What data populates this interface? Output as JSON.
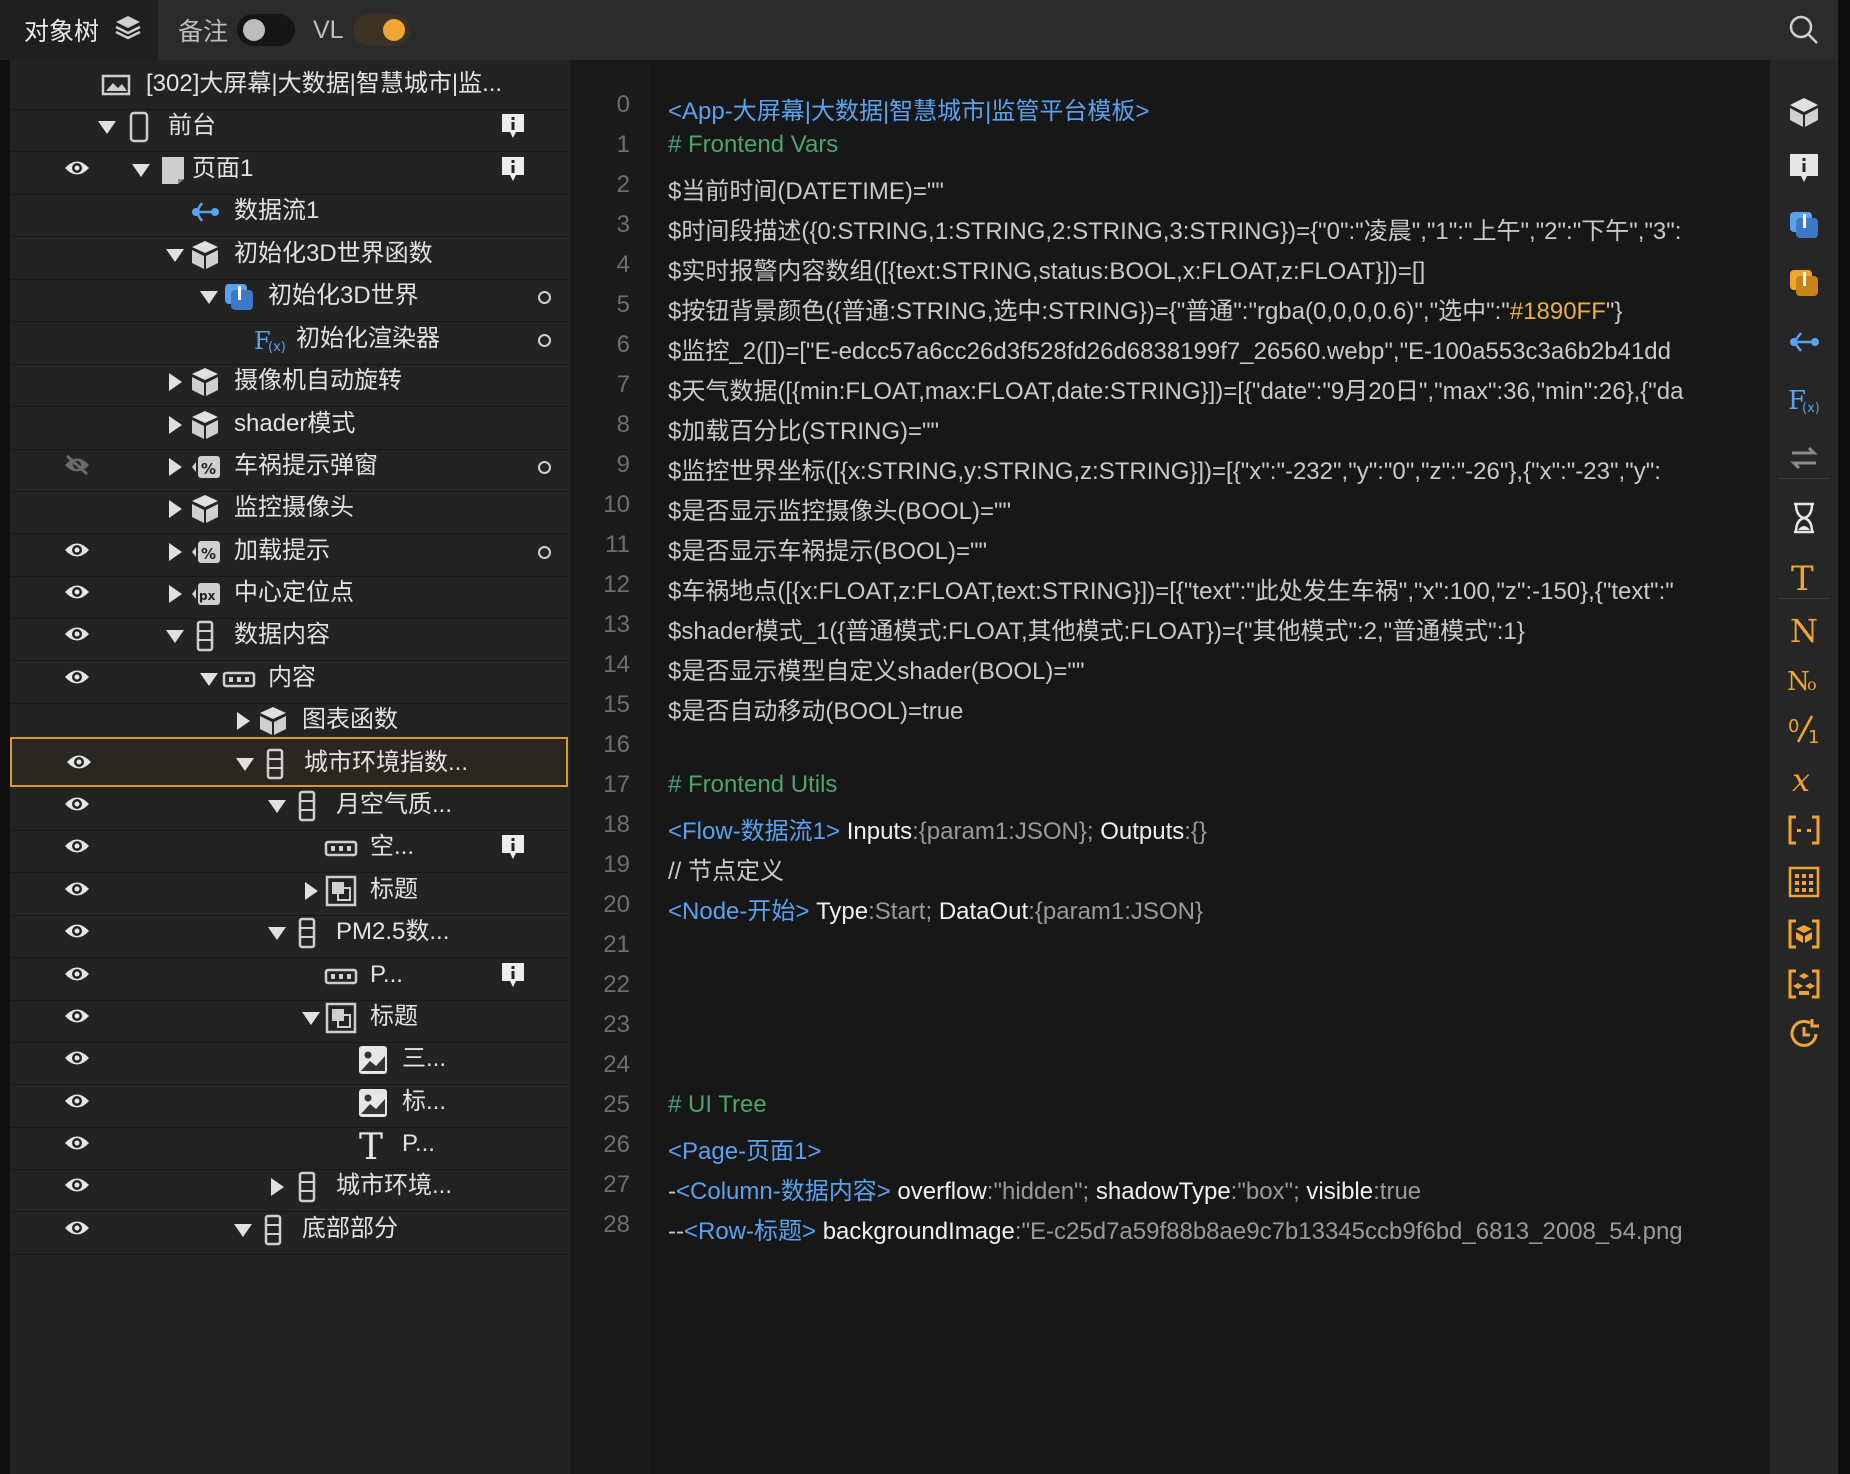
{
  "topbar": {
    "tab_object_tree": "对象树",
    "notes_label": "备注",
    "vl_label": "VL",
    "notes_toggle_on": false,
    "vl_toggle_on": true
  },
  "tree": {
    "project": "[302]大屏幕|大数据|智慧城市|监...",
    "nodes": [
      {
        "label": "前台",
        "icon": "mobile-icon",
        "expand": "down"
      },
      {
        "label": "页面1",
        "icon": "page-icon",
        "expand": "down"
      },
      {
        "label": "数据流1",
        "icon": "flow-icon",
        "expand": ""
      },
      {
        "label": "初始化3D世界函数",
        "icon": "cube-icon",
        "expand": "down"
      },
      {
        "label": "初始化3D世界",
        "icon": "scene-icon",
        "expand": "down"
      },
      {
        "label": "初始化渲染器",
        "icon": "function-icon",
        "expand": ""
      },
      {
        "label": "摄像机自动旋转",
        "icon": "cube-icon",
        "expand": "right"
      },
      {
        "label": "shader模式",
        "icon": "cube-icon",
        "expand": "right"
      },
      {
        "label": "车祸提示弹窗",
        "icon": "percent-icon",
        "expand": "right"
      },
      {
        "label": "监控摄像头",
        "icon": "cube-icon",
        "expand": "right"
      },
      {
        "label": "加载提示",
        "icon": "percent-icon",
        "expand": "right"
      },
      {
        "label": "中心定位点",
        "icon": "px-icon",
        "expand": "right"
      },
      {
        "label": "数据内容",
        "icon": "column-icon",
        "expand": "down"
      },
      {
        "label": "内容",
        "icon": "row-icon",
        "expand": "down"
      },
      {
        "label": "图表函数",
        "icon": "cube-icon",
        "expand": "right"
      },
      {
        "label": "城市环境指数...",
        "icon": "column-icon",
        "expand": "down"
      },
      {
        "label": "月空气质...",
        "icon": "column-icon",
        "expand": "down"
      },
      {
        "label": "空...",
        "icon": "row-icon",
        "expand": ""
      },
      {
        "label": "标题",
        "icon": "frame-icon",
        "expand": "right"
      },
      {
        "label": "PM2.5数...",
        "icon": "column-icon",
        "expand": "down"
      },
      {
        "label": "P...",
        "icon": "row-icon",
        "expand": ""
      },
      {
        "label": "标题",
        "icon": "frame-icon",
        "expand": "down"
      },
      {
        "label": "三...",
        "icon": "image-icon",
        "expand": ""
      },
      {
        "label": "标...",
        "icon": "image-icon",
        "expand": ""
      },
      {
        "label": "P...",
        "icon": "text-icon",
        "expand": ""
      },
      {
        "label": "城市环境...",
        "icon": "column-icon",
        "expand": "right"
      },
      {
        "label": "底部部分",
        "icon": "column-icon",
        "expand": "down"
      }
    ]
  },
  "code": {
    "line_numbers": [
      "0",
      "1",
      "2",
      "3",
      "4",
      "5",
      "6",
      "7",
      "8",
      "9",
      "10",
      "11",
      "12",
      "13",
      "14",
      "15",
      "16",
      "17",
      "18",
      "19",
      "20",
      "21",
      "22",
      "23",
      "24",
      "25",
      "26",
      "27",
      "28"
    ],
    "l0": "<App-大屏幕|大数据|智慧城市|监管平台模板>",
    "l1": "# Frontend Vars",
    "l2": "$当前时间(DATETIME)=\"\"",
    "l3": "$时间段描述({0:STRING,1:STRING,2:STRING,3:STRING})={\"0\":\"凌晨\",\"1\":\"上午\",\"2\":\"下午\",\"3\":",
    "l4": "$实时报警内容数组([{text:STRING,status:BOOL,x:FLOAT,z:FLOAT}])=[]",
    "l5a": "$按钮背景颜色({普通:STRING,选中:STRING})={\"普通\":\"rgba(0,0,0,0.6)\",\"选中\":\"",
    "l5b": "#1890FF",
    "l5c": "\"}",
    "l6": "$监控_2([])=[\"E-edcc57a6cc26d3f528fd26d6838199f7_26560.webp\",\"E-100a553c3a6b2b41dd",
    "l7": "$天气数据([{min:FLOAT,max:FLOAT,date:STRING}])=[{\"date\":\"9月20日\",\"max\":36,\"min\":26},{\"da",
    "l8": "$加载百分比(STRING)=\"\"",
    "l9": "$监控世界坐标([{x:STRING,y:STRING,z:STRING}])=[{\"x\":\"-232\",\"y\":\"0\",\"z\":\"-26\"},{\"x\":\"-23\",\"y\":",
    "l10": "$是否显示监控摄像头(BOOL)=\"\"",
    "l11": "$是否显示车祸提示(BOOL)=\"\"",
    "l12": "$车祸地点([{x:FLOAT,z:FLOAT,text:STRING}])=[{\"text\":\"此处发生车祸\",\"x\":100,\"z\":-150},{\"text\":\"",
    "l13": "$shader模式_1({普通模式:FLOAT,其他模式:FLOAT})={\"其他模式\":2,\"普通模式\":1}",
    "l14": "$是否显示模型自定义shader(BOOL)=\"\"",
    "l15": "$是否自动移动(BOOL)=true",
    "l17": "# Frontend Utils",
    "l18_tag": "<Flow-数据流1>",
    "l18_k1": "Inputs",
    "l18_v1": ":{param1:JSON};",
    "l18_k2": "Outputs",
    "l18_v2": ":{}",
    "l19": "// 节点定义",
    "l20_tag": "<Node-开始>",
    "l20_k1": "Type",
    "l20_v1": ":Start;",
    "l20_k2": "DataOut",
    "l20_v2": ":{param1:JSON}",
    "l25": "# UI Tree",
    "l26": "<Page-页面1>",
    "l27_pre": "-",
    "l27_tag": "<Column-数据内容>",
    "l27_k1": "overflow",
    "l27_v1": ":\"hidden\";",
    "l27_k2": "shadowType",
    "l27_v2": ":\"box\";",
    "l27_k3": "visible",
    "l27_v3": ":true",
    "l28_pre": "--",
    "l28_tag": "<Row-标题>",
    "l28_k1": "backgroundImage",
    "l28_v1": ":\"E-c25d7a59f88b8ae9c7b13345ccb9f6bd_6813_2008_54.png"
  },
  "toolbar": {
    "tools": [
      "cube-icon",
      "info-icon",
      "blue-scene-icon",
      "orange-scene-icon",
      "flow-icon",
      "function-icon",
      "swap-icon",
      "hourglass-icon",
      "text-t-icon",
      "text-n-icon",
      "number-icon",
      "fraction-icon",
      "variable-x-icon",
      "bracket-icon",
      "grid-icon",
      "module-icon",
      "component-icon",
      "clock-icon"
    ]
  },
  "colors": {
    "accent": "#f0a532",
    "tag": "#5aa2f0",
    "comment": "#4fa36c",
    "selection": "#d79a2b"
  }
}
